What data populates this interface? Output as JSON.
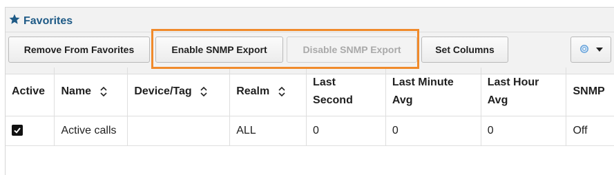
{
  "panel": {
    "title": "Favorites",
    "title_icon": "star-icon"
  },
  "toolbar": {
    "remove_label": "Remove From Favorites",
    "enable_label": "Enable SNMP Export",
    "disable_label": "Disable SNMP Export",
    "set_columns_label": "Set Columns",
    "settings_icon": "gear-icon"
  },
  "table": {
    "headers": {
      "active": "Active",
      "name": "Name",
      "device": "Device/Tag",
      "realm": "Realm",
      "last_second_1": "Last",
      "last_second_2": "Second",
      "last_minute_1": "Last Minute",
      "last_minute_2": "Avg",
      "last_hour_1": "Last Hour",
      "last_hour_2": "Avg",
      "snmp": "SNMP"
    },
    "rows": [
      {
        "active": true,
        "name": "Active calls",
        "device": "",
        "realm": "ALL",
        "last_second": "0",
        "last_minute": "0",
        "last_hour": "0",
        "snmp": "Off"
      }
    ]
  },
  "colors": {
    "title": "#1e5a86",
    "highlight": "#f08a2b"
  }
}
